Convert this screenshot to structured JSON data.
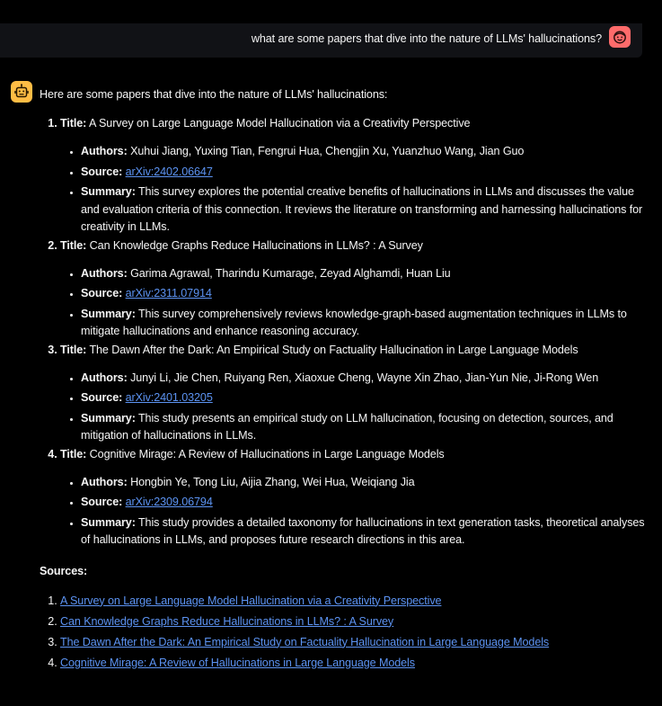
{
  "colors": {
    "background": "#000000",
    "user_bar": "#111216",
    "user_avatar": "#ff6b6b",
    "bot_avatar": "#ffbd45",
    "link": "#5c93f2",
    "text": "#f5f5f5"
  },
  "user": {
    "message": "what are some papers that dive into the nature of LLMs' hallucinations?",
    "avatar_icon": "smiling-face-icon"
  },
  "assistant": {
    "avatar_icon": "robot-icon",
    "intro": "Here are some papers that dive into the nature of LLMs' hallucinations:",
    "labels": {
      "title": "Title:",
      "authors": "Authors:",
      "source": "Source:",
      "summary": "Summary:"
    },
    "papers": [
      {
        "title": "A Survey on Large Language Model Hallucination via a Creativity Perspective",
        "authors": "Xuhui Jiang, Yuxing Tian, Fengrui Hua, Chengjin Xu, Yuanzhuo Wang, Jian Guo",
        "source": "arXiv:2402.06647",
        "summary": "This survey explores the potential creative benefits of hallucinations in LLMs and discusses the value and evaluation criteria of this connection. It reviews the literature on transforming and harnessing hallucinations for creativity in LLMs."
      },
      {
        "title": "Can Knowledge Graphs Reduce Hallucinations in LLMs? : A Survey",
        "authors": "Garima Agrawal, Tharindu Kumarage, Zeyad Alghamdi, Huan Liu",
        "source": "arXiv:2311.07914",
        "summary": "This survey comprehensively reviews knowledge-graph-based augmentation techniques in LLMs to mitigate hallucinations and enhance reasoning accuracy."
      },
      {
        "title": "The Dawn After the Dark: An Empirical Study on Factuality Hallucination in Large Language Models",
        "authors": "Junyi Li, Jie Chen, Ruiyang Ren, Xiaoxue Cheng, Wayne Xin Zhao, Jian-Yun Nie, Ji-Rong Wen",
        "source": "arXiv:2401.03205",
        "summary": "This study presents an empirical study on LLM hallucination, focusing on detection, sources, and mitigation of hallucinations in LLMs."
      },
      {
        "title": "Cognitive Mirage: A Review of Hallucinations in Large Language Models",
        "authors": "Hongbin Ye, Tong Liu, Aijia Zhang, Wei Hua, Weiqiang Jia",
        "source": "arXiv:2309.06794",
        "summary": "This study provides a detailed taxonomy for hallucinations in text generation tasks, theoretical analyses of hallucinations in LLMs, and proposes future research directions in this area."
      }
    ],
    "sources_title": "Sources:",
    "sources": [
      "A Survey on Large Language Model Hallucination via a Creativity Perspective",
      "Can Knowledge Graphs Reduce Hallucinations in LLMs? : A Survey",
      "The Dawn After the Dark: An Empirical Study on Factuality Hallucination in Large Language Models",
      "Cognitive Mirage: A Review of Hallucinations in Large Language Models"
    ]
  }
}
